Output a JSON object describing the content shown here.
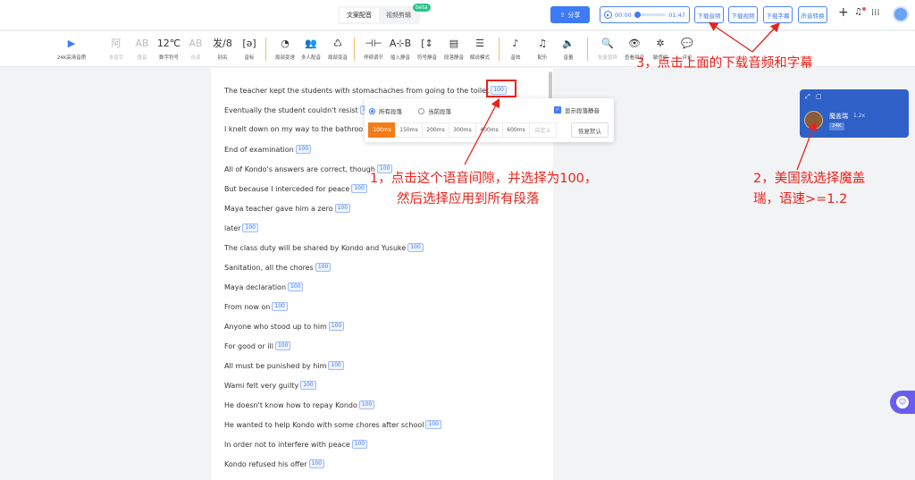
{
  "topbar": {
    "tabs": [
      "文案配音",
      "视频剪辑"
    ],
    "beta": "beta",
    "share": "分享",
    "player": {
      "current": "00:00",
      "total": "01:47",
      "progress": 0
    },
    "buttons": [
      "下载音频",
      "下载视频",
      "下载字幕",
      "声音转换"
    ],
    "plus": "+",
    "bell": "🔔",
    "grid": "⋮⋮"
  },
  "toolbar": {
    "items": [
      {
        "icon": "▶",
        "label": "24K高清音质"
      },
      {
        "icon": "阿",
        "label": "多音字"
      },
      {
        "icon": "AB",
        "label": "重音"
      },
      {
        "icon": "12℃",
        "label": "数字符号"
      },
      {
        "icon": "AB",
        "label": "连读"
      },
      {
        "icon": "发/8",
        "label": "别名"
      },
      {
        "icon": "[ə]",
        "label": "音标"
      },
      {
        "icon": "◔",
        "label": "局部变速"
      },
      {
        "icon": "👥",
        "label": "多人配音"
      },
      {
        "icon": "♺",
        "label": "局部变音"
      },
      {
        "icon": "⊣⊢",
        "label": "停顿调节"
      },
      {
        "icon": "A⊹B",
        "label": "插入静音"
      },
      {
        "icon": "[↕",
        "label": "符号静音"
      },
      {
        "icon": "▤",
        "label": "段落静音"
      },
      {
        "icon": "☰",
        "label": "解说模式"
      },
      {
        "icon": "♪",
        "label": "音效"
      },
      {
        "icon": "♫",
        "label": "配乐"
      },
      {
        "icon": "🔈",
        "label": "音量"
      },
      {
        "icon": "🔍",
        "label": "批量替换"
      },
      {
        "icon": "👁",
        "label": "查看拼音"
      },
      {
        "icon": "✲",
        "label": "敏感词"
      },
      {
        "icon": "💬",
        "label": "评论"
      }
    ]
  },
  "lines": [
    "The teacher kept the students with stomachaches from going to the toilet",
    "Eventually the student couldn't resist",
    "I knelt down on my way to the bathroo",
    "End of examination",
    "All of Kondo's answers are correct, though",
    "But because I interceded for peace",
    "Maya teacher gave him a zero",
    "later",
    "The class duty will be shared by Kondo and Yusuke",
    "Sanitation, all the chores",
    "Maya declaration",
    "From now on",
    "Anyone who stood up to him",
    "For good or ill",
    "All must be punished by him",
    "Wami felt very guilty",
    "He doesn't know how to repay Kondo",
    "He wanted to help Kondo with some chores after school",
    "In order not to interfere with peace",
    "Kondo refused his offer"
  ],
  "pause_value": "100",
  "popup": {
    "scope_all": "所有段落",
    "scope_current": "当前段落",
    "show_silence": "显示段落静音",
    "options": [
      "100ms",
      "150ms",
      "200ms",
      "300ms",
      "400ms",
      "600ms",
      "自定义"
    ],
    "selected": "100ms",
    "reset": "恢复默认"
  },
  "voice": {
    "name": "魔盖瑞",
    "speed": "1.2x",
    "badge": "24K"
  },
  "annotations": {
    "a1_line1": "1，点击这个语音间隙，并选择为100，",
    "a1_line2": "然后选择应用到所有段落",
    "a2_line1": "2，美国就选择魔盖",
    "a2_line2": "瑞，语速>=1.2",
    "a3": "3，点击上面的下载音频和字幕"
  },
  "colors": {
    "accent": "#3d7bf7",
    "annotation": "#e8231c",
    "selected_option": "#f07d1a"
  }
}
